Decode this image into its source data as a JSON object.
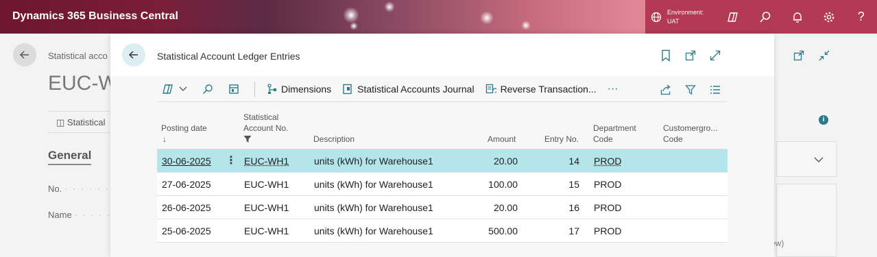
{
  "app": {
    "brand": "Dynamics 365 Business Central",
    "environment_label": "Environment:",
    "environment_value": "UAT",
    "top_icons": [
      "copilot-icon",
      "search-icon",
      "bell-icon",
      "gear-icon",
      "help-icon"
    ],
    "help_glyph": "?"
  },
  "background_page": {
    "breadcrumb": "Statistical acco",
    "title": "EUC-WH",
    "action_label": "Statistical",
    "section": "General",
    "fields": [
      "No.",
      "Name"
    ],
    "view_text": "ew)",
    "info_glyph": "i"
  },
  "modal": {
    "title": "Statistical Account Ledger Entries",
    "toolbar": {
      "dimensions": "Dimensions",
      "journal": "Statistical Accounts Journal",
      "reverse": "Reverse Transaction...",
      "more": "···"
    },
    "columns": {
      "posting_date": "Posting date",
      "sort_arrow": "↓",
      "account_no_1": "Statistical",
      "account_no_2": "Account No.",
      "description": "Description",
      "amount": "Amount",
      "entry_no": "Entry No.",
      "department_1": "Department",
      "department_2": "Code",
      "customergroup_1": "Customergro...",
      "customergroup_2": "Code"
    },
    "rows": [
      {
        "date": "30-06-2025",
        "account": "EUC-WH1",
        "description": "units (kWh) for Warehouse1",
        "amount": "20.00",
        "entry": "14",
        "department": "PROD",
        "customergroup": ""
      },
      {
        "date": "27-06-2025",
        "account": "EUC-WH1",
        "description": "units (kWh) for Warehouse1",
        "amount": "100.00",
        "entry": "15",
        "department": "PROD",
        "customergroup": ""
      },
      {
        "date": "26-06-2025",
        "account": "EUC-WH1",
        "description": "units (kWh) for Warehouse1",
        "amount": "20.00",
        "entry": "16",
        "department": "PROD",
        "customergroup": ""
      },
      {
        "date": "25-06-2025",
        "account": "EUC-WH1",
        "description": "units (kWh) for Warehouse1",
        "amount": "500.00",
        "entry": "17",
        "department": "PROD",
        "customergroup": ""
      }
    ],
    "row_menu": "⋮"
  },
  "colors": {
    "accent": "#2a7a8c",
    "selected_row": "#b3e5ea",
    "topbar_right": "#b23a55"
  }
}
